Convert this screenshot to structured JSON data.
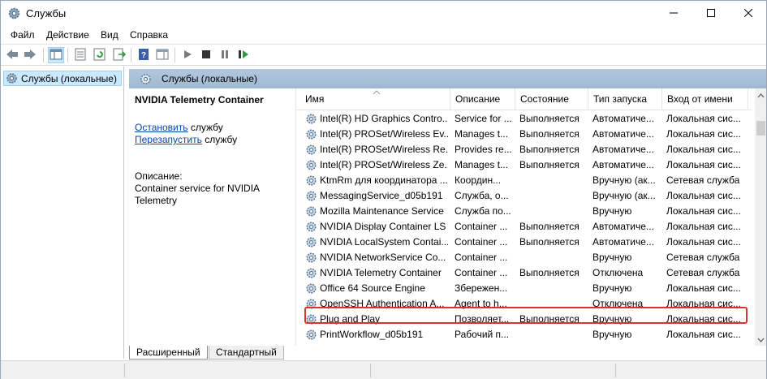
{
  "window": {
    "title": "Службы",
    "controls": {
      "minimize": "minimize-icon",
      "maximize": "maximize-icon",
      "close": "close-icon"
    }
  },
  "menu": [
    "Файл",
    "Действие",
    "Вид",
    "Справка"
  ],
  "tree": {
    "item": "Службы (локальные)"
  },
  "pane": {
    "header": "Службы (локальные)",
    "selected_service": "NVIDIA Telemetry Container",
    "action1_link": "Остановить",
    "action1_suffix": " службу",
    "action2_link": "Перезапустить",
    "action2_suffix": " службу",
    "desc_label": "Описание:",
    "desc_text": "Container service for NVIDIA Telemetry"
  },
  "table": {
    "columns": [
      "Имя",
      "Описание",
      "Состояние",
      "Тип запуска",
      "Вход от имени"
    ],
    "rows": [
      [
        "Intel(R) HD Graphics Contro...",
        "Service for ...",
        "Выполняется",
        "Автоматиче...",
        "Локальная сис..."
      ],
      [
        "Intel(R) PROSet/Wireless Ev...",
        "Manages t...",
        "Выполняется",
        "Автоматиче...",
        "Локальная сис..."
      ],
      [
        "Intel(R) PROSet/Wireless Re...",
        "Provides re...",
        "Выполняется",
        "Автоматиче...",
        "Локальная сис..."
      ],
      [
        "Intel(R) PROSet/Wireless Ze...",
        "Manages t...",
        "Выполняется",
        "Автоматиче...",
        "Локальная сис..."
      ],
      [
        "KtmRm для координатора ...",
        "Координ...",
        "",
        "Вручную (ак...",
        "Сетевая служба"
      ],
      [
        "MessagingService_d05b191",
        "Служба, о...",
        "",
        "Вручную (ак...",
        "Локальная сис..."
      ],
      [
        "Mozilla Maintenance Service",
        "Служба по...",
        "",
        "Вручную",
        "Локальная сис..."
      ],
      [
        "NVIDIA Display Container LS",
        "Container ...",
        "Выполняется",
        "Автоматиче...",
        "Локальная сис..."
      ],
      [
        "NVIDIA LocalSystem Contai...",
        "Container ...",
        "Выполняется",
        "Автоматиче...",
        "Локальная сис..."
      ],
      [
        "NVIDIA NetworkService Co...",
        "Container ...",
        "",
        "Вручную",
        "Сетевая служба"
      ],
      [
        "NVIDIA Telemetry Container",
        "Container ...",
        "Выполняется",
        "Отключена",
        "Сетевая служба"
      ],
      [
        "Office 64 Source Engine",
        "Збережен...",
        "",
        "Вручную",
        "Локальная сис..."
      ],
      [
        "OpenSSH Authentication A...",
        "Agent to h...",
        "",
        "Отключена",
        "Локальная сис..."
      ],
      [
        "Plug and Play",
        "Позволяет...",
        "Выполняется",
        "Вручную",
        "Локальная сис..."
      ],
      [
        "PrintWorkflow_d05b191",
        "Рабочий п...",
        "",
        "Вручную",
        "Локальная сис..."
      ]
    ],
    "highlighted_row_index": 10
  },
  "tabs": [
    "Расширенный",
    "Стандартный"
  ],
  "colors": {
    "highlight_border": "#d9342b",
    "link": "#0645ad",
    "pane_header": "#b2c8df"
  }
}
